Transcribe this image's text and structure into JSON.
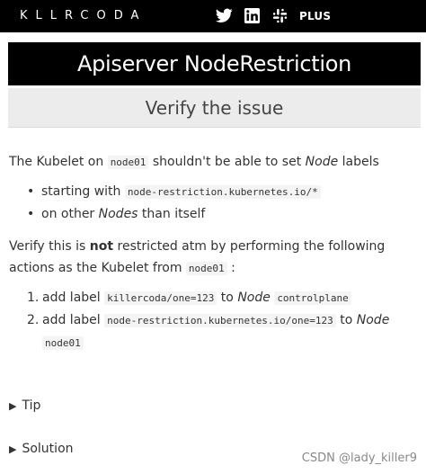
{
  "header": {
    "logo_text": "KLLRCODA",
    "icons": [
      "twitter-icon",
      "linkedin-icon",
      "slack-icon"
    ],
    "plus_label": "PLUS"
  },
  "title": "Apiserver NodeRestriction",
  "step_title": "Verify the issue",
  "intro": {
    "t1": "The Kubelet on ",
    "code1": "node01",
    "t2": " shouldn't be able to set ",
    "em1": "Node",
    "t3": " labels"
  },
  "bullets": [
    {
      "text": "starting with ",
      "code": "node-restriction.kubernetes.io/*"
    },
    {
      "text": "on other ",
      "em": "Nodes",
      "tail": " than itself"
    }
  ],
  "verify": {
    "t1": "Verify this is ",
    "strong": "not",
    "t2": " restricted atm by performing the following actions as the Kubelet from ",
    "code": "node01",
    "t3": " :"
  },
  "steps": [
    {
      "num": "1.",
      "text": "add label ",
      "code": "killercoda/one=123",
      "mid": " to ",
      "em": "Node",
      "code2": "controlplane"
    },
    {
      "num": "2.",
      "text": "add label ",
      "code": "node-restriction.kubernetes.io/one=123",
      "mid": " to ",
      "em": "Node",
      "code2": "node01"
    }
  ],
  "details": [
    {
      "label": "Tip"
    },
    {
      "label": "Solution"
    }
  ],
  "watermark": "CSDN @lady_killer9"
}
